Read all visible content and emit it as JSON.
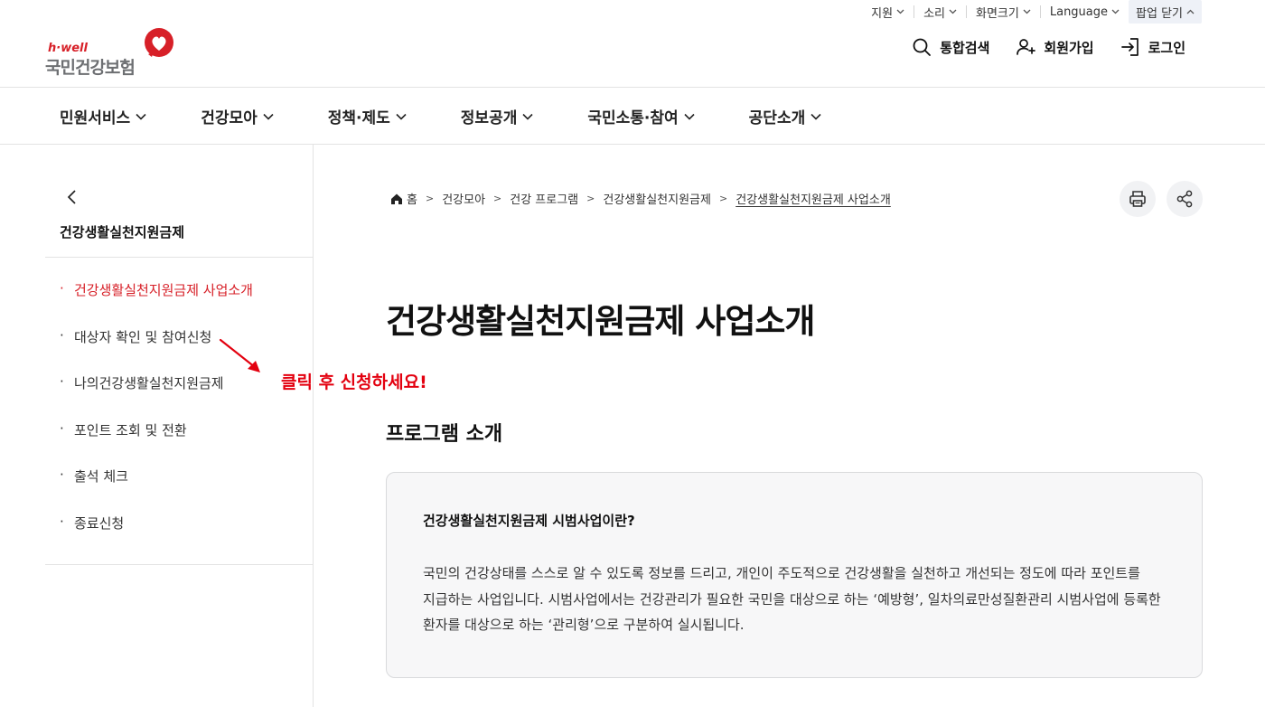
{
  "util_bar": {
    "items": [
      {
        "label": "지원"
      },
      {
        "label": "소리"
      },
      {
        "label": "화면크기"
      },
      {
        "label": "Language"
      }
    ],
    "popup_close": "팝업 닫기"
  },
  "logo": {
    "small": "h·well",
    "main": "국민건강보험"
  },
  "header_actions": {
    "search": "통합검색",
    "signup": "회원가입",
    "login": "로그인"
  },
  "gnb": [
    {
      "label": "민원서비스"
    },
    {
      "label": "건강모아"
    },
    {
      "label": "정책·제도"
    },
    {
      "label": "정보공개"
    },
    {
      "label": "국민소통·참여"
    },
    {
      "label": "공단소개"
    }
  ],
  "sidebar": {
    "title": "건강생활실천지원금제",
    "items": [
      {
        "label": "건강생활실천지원금제 사업소개",
        "active": true
      },
      {
        "label": "대상자 확인 및 참여신청",
        "active": false
      },
      {
        "label": "나의건강생활실천지원금제",
        "active": false
      },
      {
        "label": "포인트 조회 및 전환",
        "active": false
      },
      {
        "label": "출석 체크",
        "active": false
      },
      {
        "label": "종료신청",
        "active": false
      }
    ]
  },
  "annotation": {
    "text": "클릭 후 신청하세요!"
  },
  "breadcrumb": {
    "items": [
      "홈",
      "건강모아",
      "건강 프로그램",
      "건강생활실천지원금제",
      "건강생활실천지원금제 사업소개"
    ]
  },
  "page_title": "건강생활실천지원금제 사업소개",
  "section_title": "프로그램 소개",
  "info_box": {
    "title": "건강생활실천지원금제 시범사업이란?",
    "body": "국민의 건강상태를 스스로 알 수 있도록 정보를 드리고, 개인이 주도적으로 건강생활을 실천하고 개선되는 정도에 따라 포인트를 지급하는 사업입니다. 시범사업에서는 건강관리가 필요한 국민을 대상으로 하는 ‘예방형’, 일차의료만성질환관리 시범사업에 등록한 환자를 대상으로 하는 ‘관리형’으로 구분하여 실시됩니다."
  },
  "colors": {
    "brand_red": "#d72028",
    "annotation_red": "#e3000f",
    "text_dark": "#111111",
    "border": "#e3e3e3",
    "box_bg": "#f7f7f8"
  },
  "icons": [
    "search-icon",
    "user-plus-icon",
    "login-icon",
    "home-icon",
    "print-icon",
    "share-icon",
    "chevron-left-icon",
    "chevron-down-icon",
    "heart-logo-icon"
  ]
}
